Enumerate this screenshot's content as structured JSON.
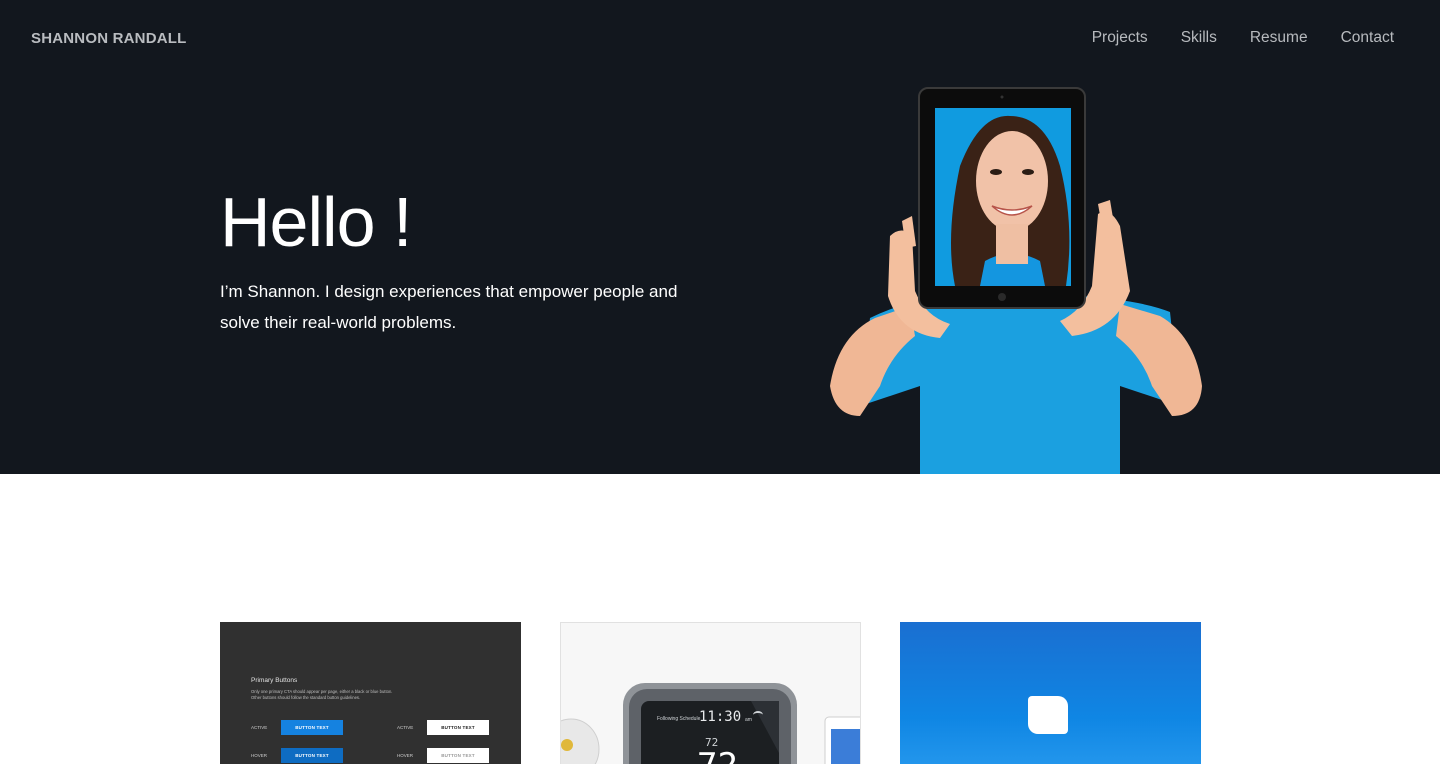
{
  "header": {
    "brand": "SHANNON RANDALL",
    "nav": [
      "Projects",
      "Skills",
      "Resume",
      "Contact"
    ]
  },
  "hero": {
    "title": "Hello !",
    "subtitle": "I’m Shannon. I design experiences that empower people and solve their real-world problems."
  },
  "cards": {
    "style_guide": {
      "title": "Primary Buttons",
      "note": "Only one primary CTA should appear per page, either a black or blue button. Other buttons should follow the standard button guidelines.",
      "rows": [
        {
          "label": "ACTIVE",
          "button": "BUTTON TEXT"
        },
        {
          "label": "HOVER",
          "button": "BUTTON TEXT"
        }
      ]
    },
    "thermostat": {
      "schedule": "Following Schedule",
      "time": "11:30",
      "ampm": "am",
      "set_temp": "72",
      "current_temp": "72"
    }
  },
  "colors": {
    "hero_bg": "#12171e",
    "accent_blue": "#1582e0",
    "shirt_blue": "#1ba0e0"
  },
  "icons": [
    "portrait-photo",
    "thermostat-device",
    "app-icon"
  ]
}
